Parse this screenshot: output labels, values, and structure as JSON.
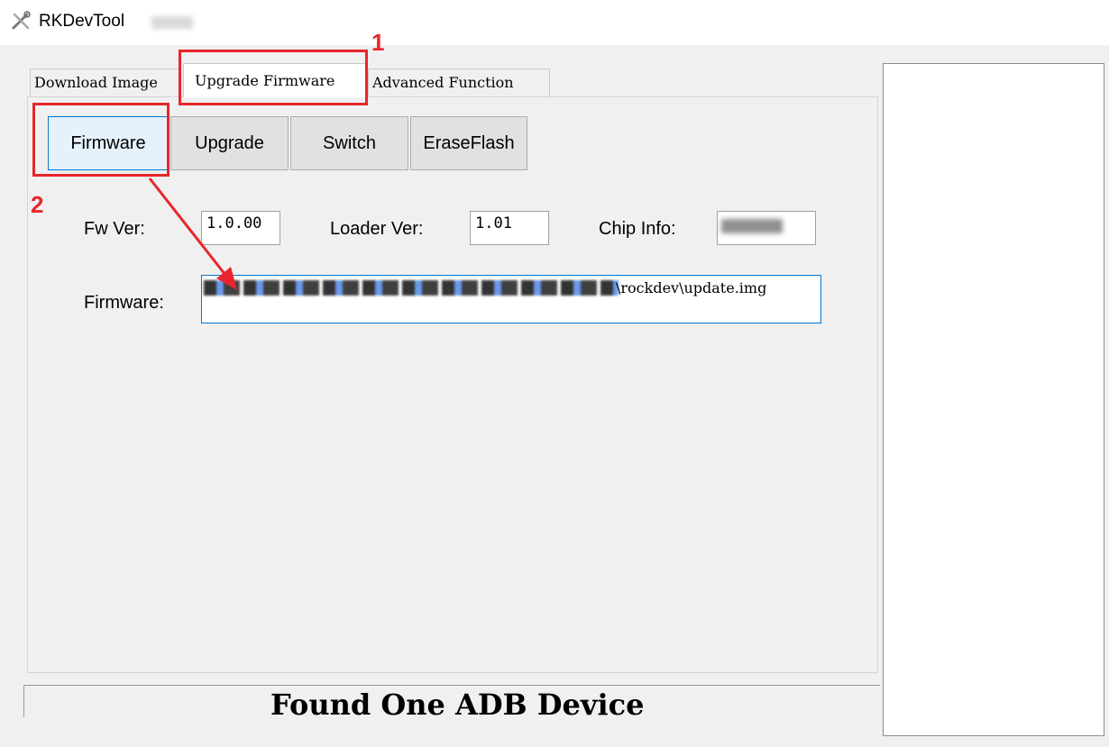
{
  "window": {
    "title": "RKDevTool"
  },
  "tabs": [
    {
      "label": "Download Image",
      "active": false
    },
    {
      "label": "Upgrade Firmware",
      "active": true
    },
    {
      "label": "Advanced Function",
      "active": false
    }
  ],
  "toolbar": {
    "firmware_label": "Firmware",
    "upgrade_label": "Upgrade",
    "switch_label": "Switch",
    "eraseflash_label": "EraseFlash"
  },
  "info": {
    "fw_ver_label": "Fw Ver:",
    "fw_ver_value": "1.0.00",
    "loader_ver_label": "Loader Ver:",
    "loader_ver_value": "1.01",
    "chip_info_label": "Chip Info:",
    "firmware_label": "Firmware:",
    "firmware_path_visible": "\\rockdev\\update.img"
  },
  "status": {
    "text": "Found One ADB Device"
  },
  "annotations": {
    "marker_1": "1",
    "marker_2": "2",
    "color": "#e8262b"
  },
  "colors": {
    "focus_border": "#0078d7",
    "window_bg": "#f0f0f0"
  }
}
